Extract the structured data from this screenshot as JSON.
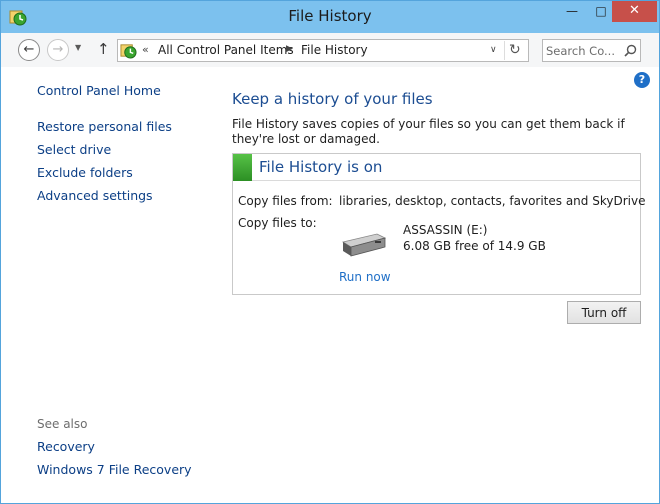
{
  "window": {
    "title": "File History"
  },
  "navbar": {
    "breadcrumb": [
      "All Control Panel Items",
      "File History"
    ],
    "search_placeholder": "Search Co..."
  },
  "sidebar": {
    "home_link": "Control Panel Home",
    "links": [
      "Restore personal files",
      "Select drive",
      "Exclude folders",
      "Advanced settings"
    ],
    "see_also_label": "See also",
    "see_also_links": [
      "Recovery",
      "Windows 7 File Recovery"
    ]
  },
  "main": {
    "heading": "Keep a history of your files",
    "description": "File History saves copies of your files so you can get them back if they're lost or damaged.",
    "status": {
      "title": "File History is on",
      "copy_from_label": "Copy files from:",
      "copy_from_value": "libraries, desktop, contacts, favorites and SkyDrive",
      "copy_to_label": "Copy files to:",
      "drive_name": "ASSASSIN (E:)",
      "drive_free": "6.08 GB free of 14.9 GB",
      "run_now_label": "Run now"
    },
    "turn_off_label": "Turn off"
  },
  "colors": {
    "title_bar": "#7cc1ee",
    "link": "#0c3f86",
    "heading": "#1c4d92",
    "status_green": "#3aa52f",
    "close_button": "#c7504a"
  },
  "icons": {
    "app": "file-history-icon",
    "back": "back-arrow-icon",
    "forward": "forward-arrow-icon",
    "up": "up-arrow-icon",
    "refresh": "refresh-icon",
    "search": "search-icon",
    "help": "help-icon",
    "drive": "removable-drive-icon"
  }
}
